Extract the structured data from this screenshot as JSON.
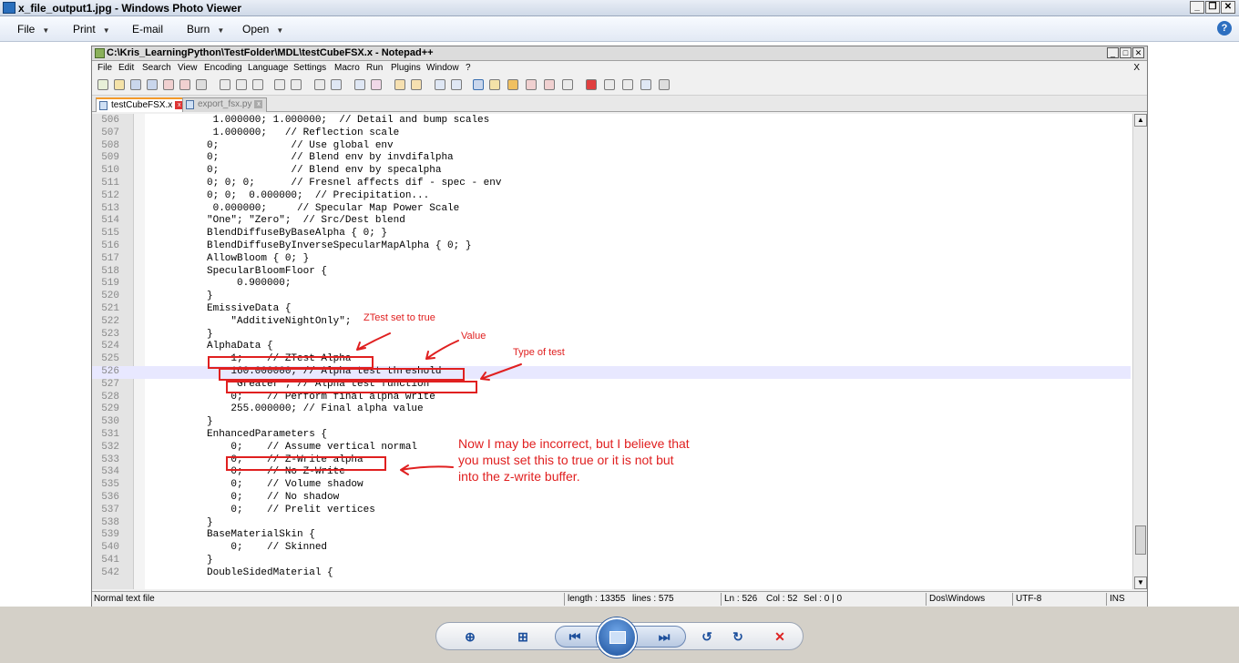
{
  "photo_viewer": {
    "title": "x_file_output1.jpg - Windows Photo Viewer",
    "menu": [
      {
        "label": "File"
      },
      {
        "label": "Print"
      },
      {
        "label": "E-mail"
      },
      {
        "label": "Burn"
      },
      {
        "label": "Open"
      }
    ]
  },
  "notepadpp": {
    "title": "C:\\Kris_LearningPython\\TestFolder\\MDL\\testCubeFSX.x - Notepad++",
    "menu": [
      "File",
      "Edit",
      "Search",
      "View",
      "Encoding",
      "Language",
      "Settings",
      "Macro",
      "Run",
      "Plugins",
      "Window",
      "?"
    ],
    "close_x": "X",
    "tabs": [
      {
        "label": "testCubeFSX.x",
        "active": true
      },
      {
        "label": "export_fsx.py",
        "active": false
      }
    ],
    "lines": [
      {
        "n": "506",
        "t": " 1.000000; 1.000000;  // Detail and bump scales"
      },
      {
        "n": "507",
        "t": " 1.000000;   // Reflection scale"
      },
      {
        "n": "508",
        "t": "0;            // Use global env"
      },
      {
        "n": "509",
        "t": "0;            // Blend env by invdifalpha"
      },
      {
        "n": "510",
        "t": "0;            // Blend env by specalpha"
      },
      {
        "n": "511",
        "t": "0; 0; 0;      // Fresnel affects dif - spec - env"
      },
      {
        "n": "512",
        "t": "0; 0;  0.000000;  // Precipitation..."
      },
      {
        "n": "513",
        "t": " 0.000000;     // Specular Map Power Scale"
      },
      {
        "n": "514",
        "t": "\"One\"; \"Zero\";  // Src/Dest blend"
      },
      {
        "n": "515",
        "t": "BlendDiffuseByBaseAlpha { 0; }"
      },
      {
        "n": "516",
        "t": "BlendDiffuseByInverseSpecularMapAlpha { 0; }"
      },
      {
        "n": "517",
        "t": "AllowBloom { 0; }"
      },
      {
        "n": "518",
        "t": "SpecularBloomFloor {"
      },
      {
        "n": "519",
        "t": "     0.900000;"
      },
      {
        "n": "520",
        "t": "}"
      },
      {
        "n": "521",
        "t": "EmissiveData {"
      },
      {
        "n": "522",
        "t": "    \"AdditiveNightOnly\";"
      },
      {
        "n": "523",
        "t": "}"
      },
      {
        "n": "524",
        "t": "AlphaData {"
      },
      {
        "n": "525",
        "t": "    1;    // ZTest Alpha"
      },
      {
        "n": "526",
        "t": "    160.000000; // Alpha test threshold"
      },
      {
        "n": "527",
        "t": "    \"Greater\"; // Alpha test function"
      },
      {
        "n": "528",
        "t": "    0;    // Perform final alpha write"
      },
      {
        "n": "529",
        "t": "    255.000000; // Final alpha value"
      },
      {
        "n": "530",
        "t": "}"
      },
      {
        "n": "531",
        "t": "EnhancedParameters {"
      },
      {
        "n": "532",
        "t": "    0;    // Assume vertical normal"
      },
      {
        "n": "533",
        "t": "    0;    // Z-Write alpha"
      },
      {
        "n": "534",
        "t": "    0;    // No Z-Write"
      },
      {
        "n": "535",
        "t": "    0;    // Volume shadow"
      },
      {
        "n": "536",
        "t": "    0;    // No shadow"
      },
      {
        "n": "537",
        "t": "    0;    // Prelit vertices"
      },
      {
        "n": "538",
        "t": "}"
      },
      {
        "n": "539",
        "t": "BaseMaterialSkin {"
      },
      {
        "n": "540",
        "t": "    0;    // Skinned"
      },
      {
        "n": "541",
        "t": "}"
      },
      {
        "n": "542",
        "t": "DoubleSidedMaterial {"
      }
    ],
    "current_line": "526",
    "status": {
      "type": "Normal text file",
      "length": "length : 13355",
      "lines": "lines : 575",
      "ln": "Ln : 526",
      "col": "Col : 52",
      "sel": "Sel : 0 | 0",
      "eol": "Dos\\Windows",
      "enc": "UTF-8",
      "ins": "INS"
    }
  },
  "annotations": {
    "ztest": "ZTest set to true",
    "value": "Value",
    "type": "Type of test",
    "note": "Now I may be incorrect, but I believe that you must set this to true or it is not but into the z-write buffer."
  },
  "colors": {
    "annotation": "#e02020",
    "current_line": "#e8e8ff"
  },
  "controls": [
    "zoom-icon",
    "fit-window-icon",
    "previous-icon",
    "slideshow-icon",
    "next-icon",
    "rotate-ccw-icon",
    "rotate-cw-icon",
    "delete-icon"
  ]
}
